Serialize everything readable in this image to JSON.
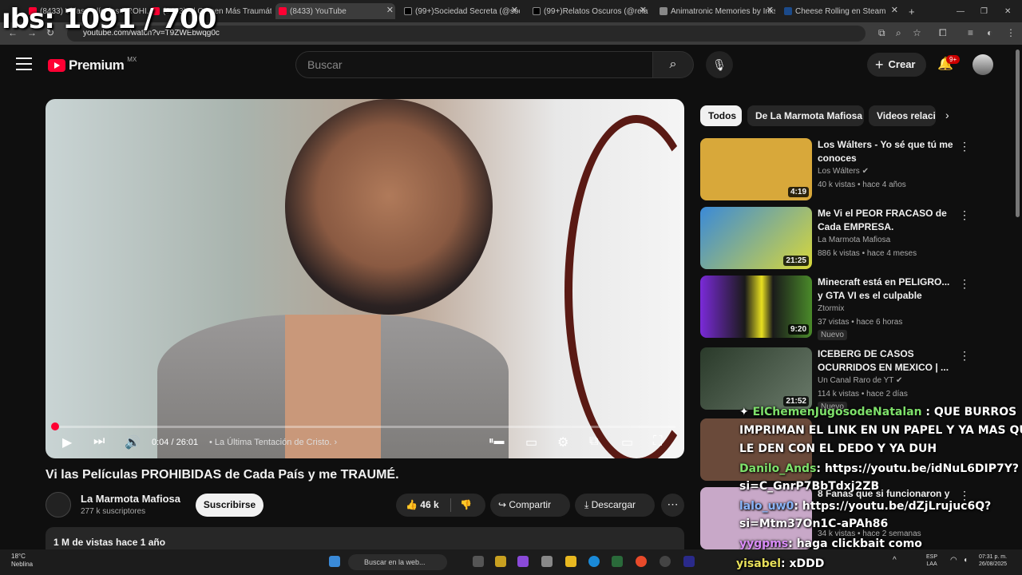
{
  "overlay": {
    "subs_counter": "ıbs: 1091 / 700"
  },
  "browser": {
    "tabs": [
      {
        "label": "(8433) Vi las Películas PROHI...",
        "color": "#ff0033"
      },
      {
        "label": "(8433) El Crimen Más Traumátic",
        "color": "#ff0033"
      },
      {
        "label": "(8433) YouTube",
        "color": "#ff0033"
      },
      {
        "label": "(99+)Sociedad Secreta (@socie",
        "color": "#000000"
      },
      {
        "label": "(99+)Relatos Oscuros (@relato",
        "color": "#000000"
      },
      {
        "label": "Animatronic Memories by Inksi",
        "color": "#888888"
      },
      {
        "label": "Cheese Rolling en Steam",
        "color": "#1b4a8a"
      }
    ],
    "url": "youtube.com/watch?v=T9ZWEbwqg0c"
  },
  "header": {
    "brand": "Premium",
    "country": "MX",
    "search_placeholder": "Buscar",
    "create": "Crear",
    "notif_count": "9+"
  },
  "player": {
    "time": "0:04 / 26:01",
    "chapter": "La Última Tentación de Cristo.",
    "progress_fraction": 0.003
  },
  "video": {
    "title": "Vi las Películas PROHIBIDAS de Cada País y me TRAUMÉ.",
    "channel": "La Marmota Mafiosa",
    "subscribers": "277 k suscriptores",
    "subscribe": "Suscribirse",
    "likes": "46 k",
    "share": "Compartir",
    "download": "Descargar",
    "views": "1 M de vistas  hace 1 año"
  },
  "chips": [
    "Todos",
    "De La Marmota Mafiosa",
    "Videos relacionados"
  ],
  "recommendations": [
    {
      "title": "Los Wálters - Yo sé que tú me conoces",
      "channel": "Los Wálters",
      "verified": true,
      "meta": "40 k vistas • hace 4 años",
      "duration": "4:19",
      "thumb": "#d8a83a"
    },
    {
      "title": "Me Vi el PEOR FRACASO de Cada EMPRESA.",
      "channel": "La Marmota Mafiosa",
      "verified": false,
      "meta": "886 k vistas • hace 4 meses",
      "duration": "21:25",
      "thumb": "#3a8ad8"
    },
    {
      "title": "Minecraft está en PELIGRO... y GTA VI es el culpable",
      "channel": "Ztormix",
      "verified": false,
      "meta": "37 vistas • hace 6 horas",
      "duration": "9:20",
      "thumb": "#1a1a1a",
      "badge": "Nuevo"
    },
    {
      "title": "ICEBERG DE CASOS OCURRIDOS EN MEXICO | ...",
      "channel": "Un Canal Raro de YT",
      "verified": true,
      "meta": "114 k vistas • hace 2 días",
      "duration": "21:52",
      "thumb": "#4a5a4a",
      "badge": "Nuevo"
    },
    {
      "title": "",
      "channel": "",
      "verified": false,
      "meta": "",
      "duration": "",
      "thumb": "#6a4a3a"
    },
    {
      "title": "8 Fanas que si funcionaron y",
      "channel": "",
      "verified": false,
      "meta": "34 k vistas • hace 2 semanas",
      "duration": "",
      "thumb": "#c8a8c8"
    }
  ],
  "chat": [
    {
      "user": "ElChemenJugosodeNatalan",
      "msg": " : QUE BURROS"
    },
    {
      "user": "",
      "msg": "IMPRIMAN EL LINK EN UN PAPEL Y YA  MAS QUE"
    },
    {
      "user": "",
      "msg": "LE DEN CON EL DEDO Y YA DUH"
    },
    {
      "user": "Danilo_Ands",
      "msg": ": https://youtu.be/idNuL6DIP7Y?"
    },
    {
      "user": "",
      "msg": "si=C_GnrP7BbTdxj2ZB"
    },
    {
      "user": "lalo_uw0",
      "msg": ": https://youtu.be/dZjLrujuc6Q?"
    },
    {
      "user": "",
      "msg": "si=Mtm37On1C-aPAh86"
    },
    {
      "user": "yygpms",
      "msg": ": haga clickbait como"
    },
    {
      "user": "yisabel",
      "msg": ": xDDD"
    }
  ],
  "taskbar": {
    "temp": "18°C",
    "weather": "Neblina",
    "search": "Buscar en la web...",
    "lang1": "ESP",
    "lang2": "LAA",
    "time": "07:31 p. m.",
    "date": "26/08/2025"
  }
}
